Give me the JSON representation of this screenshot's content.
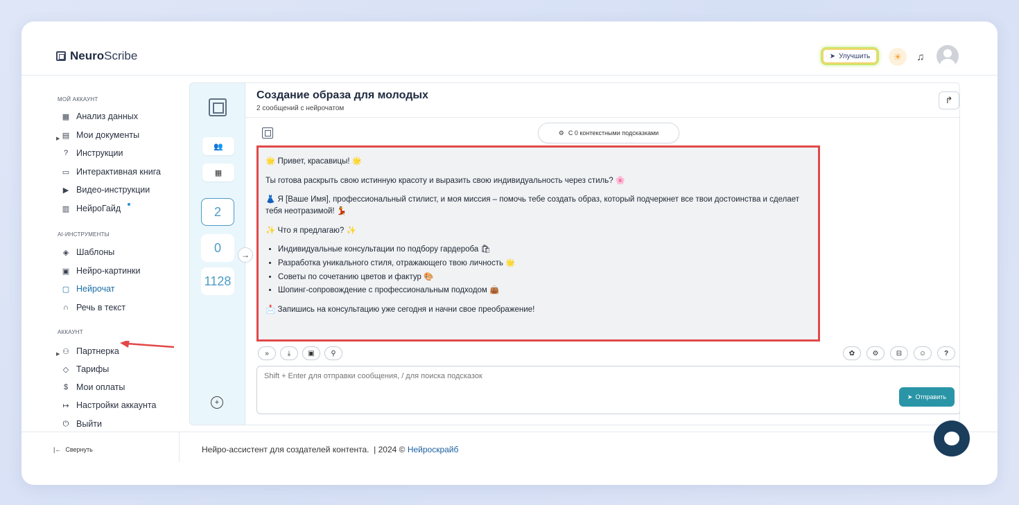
{
  "app": {
    "logo_bold": "Neuro",
    "logo_rest": "Scribe"
  },
  "header": {
    "upgrade_label": "Улучшить",
    "sun_icon": "sun-icon",
    "bell_icon": "bell-icon",
    "avatar_icon": "avatar-icon"
  },
  "sidebar": {
    "section_account": "МОЙ АККАУНТ",
    "items_account": [
      {
        "label": "Анализ данных",
        "icon": "grid-icon",
        "glyph": "▦"
      },
      {
        "label": "Мои документы",
        "icon": "document-icon",
        "glyph": "▤"
      },
      {
        "label": "Инструкции",
        "icon": "help-icon",
        "glyph": "?"
      },
      {
        "label": "Интерактивная книга",
        "icon": "book-icon",
        "glyph": "▭"
      },
      {
        "label": "Видео-инструкции",
        "icon": "video-icon",
        "glyph": "▶"
      },
      {
        "label": "НейроГайд",
        "icon": "guide-icon",
        "glyph": "▥"
      }
    ],
    "section_ai": "AI-ИНСТРУМЕНТЫ",
    "items_ai": [
      {
        "label": "Шаблоны",
        "icon": "layers-icon",
        "glyph": "◈"
      },
      {
        "label": "Нейро-картинки",
        "icon": "image-icon",
        "glyph": "▣"
      },
      {
        "label": "Нейрочат",
        "icon": "chat-icon",
        "glyph": "▢"
      },
      {
        "label": "Речь в текст",
        "icon": "headphones-icon",
        "glyph": "∩"
      }
    ],
    "section_acc2": "АККАУНТ",
    "items_acc2": [
      {
        "label": "Партнерка",
        "icon": "users-icon",
        "glyph": "⚇"
      },
      {
        "label": "Тарифы",
        "icon": "tag-icon",
        "glyph": "◇"
      },
      {
        "label": "Мои оплаты",
        "icon": "dollar-icon",
        "glyph": "$"
      },
      {
        "label": "Настройки аккаунта",
        "icon": "login-icon",
        "glyph": "↦"
      },
      {
        "label": "Выйти",
        "icon": "power-icon",
        "glyph": "⏻"
      }
    ],
    "collapse_label": "Свернуть"
  },
  "rail": {
    "counts": [
      "2",
      "0",
      "1128"
    ]
  },
  "chat": {
    "title": "Создание образа для молодых",
    "subtitle": "2 сообщений с нейрочатом",
    "hints_label": "С 0 контекстными подсказками",
    "message": {
      "p1": "🌟 Привет, красавицы! 🌟",
      "p2": "Ты готова раскрыть свою истинную красоту и выразить свою индивидуальность через стиль? 🌸",
      "p3": "👗 Я [Ваше Имя], профессиональный стилист, и моя миссия – помочь тебе создать образ, который подчеркнет все твои достоинства и сделает тебя неотразимой! 💃",
      "p4": "✨ Что я предлагаю? ✨",
      "bullets": [
        "Индивидуальные консультации по подбору гардероба 🛍",
        "Разработка уникального стиля, отражающего твою личность 🌟",
        "Советы по сочетанию цветов и фактур 🎨",
        "Шопинг-сопровождение с профессиональным подходом 👜"
      ],
      "p5": "📩 Запишись на консультацию уже сегодня и начни свое преображение!"
    },
    "input_placeholder": "Shift + Enter для отправки сообщения, / для поиска подсказок",
    "send_label": "Отправить"
  },
  "footer": {
    "text": "Нейро-ассистент для создателей контента.  | 2024 © ",
    "link": "Нейроскрайб"
  },
  "colors": {
    "accent": "#1a6fa8",
    "highlight_border": "#e24848",
    "send_button": "#2a95a7",
    "rail_bg": "#e9f6fc"
  }
}
